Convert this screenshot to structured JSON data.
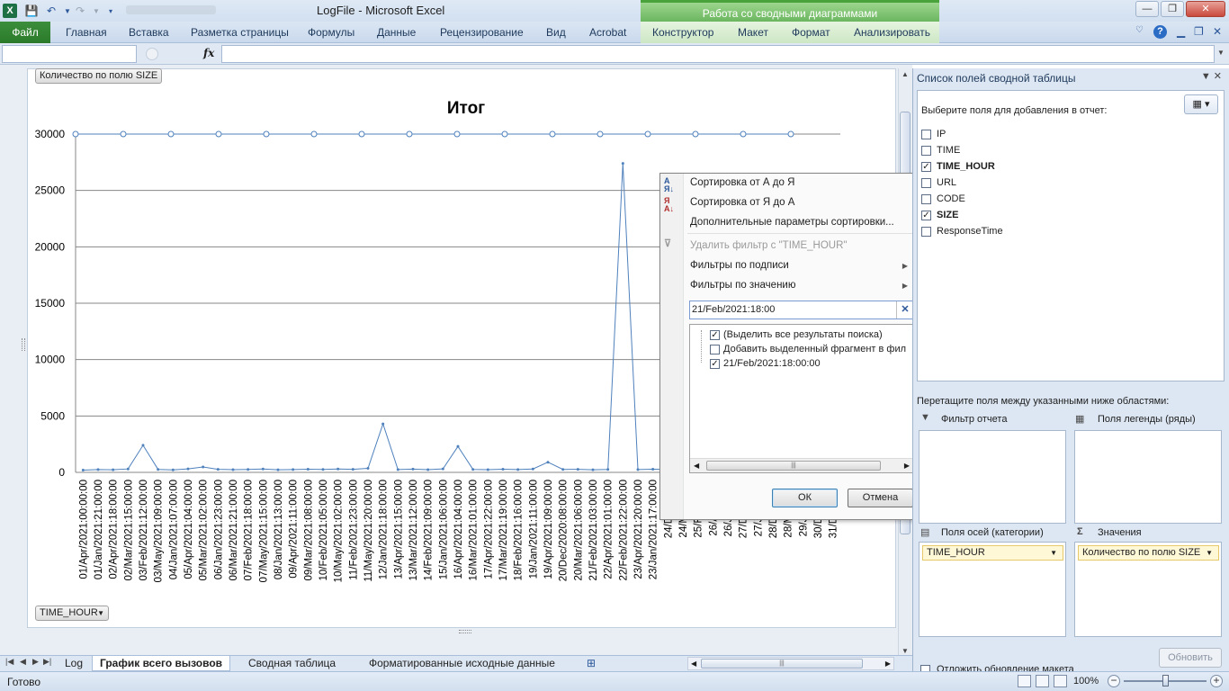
{
  "window": {
    "title": "LogFile  -  Microsoft Excel",
    "context_group": "Работа со сводными диаграммами",
    "controls": {
      "minimize": "—",
      "restore": "❐",
      "close": "✕"
    }
  },
  "ribbon": {
    "file_tab": "Файл",
    "tabs": [
      "Главная",
      "Вставка",
      "Разметка страницы",
      "Формулы",
      "Данные",
      "Рецензирование",
      "Вид",
      "Acrobat"
    ],
    "context_tabs": [
      "Конструктор",
      "Макет",
      "Формат",
      "Анализировать"
    ]
  },
  "formula_bar": {
    "fx": "fx",
    "name_box": "",
    "value": ""
  },
  "chart": {
    "value_field_button": "Количество по полю SIZE",
    "axis_field_button": "TIME_HOUR",
    "line_color": "#4f81bd"
  },
  "chart_data": {
    "type": "line",
    "title": "Итог",
    "xlabel": "",
    "ylabel": "",
    "ylim": [
      0,
      30000
    ],
    "yticks": [
      0,
      5000,
      10000,
      15000,
      20000,
      25000,
      30000
    ],
    "grid": true,
    "categories": [
      "01/Apr/2021:00:00:00",
      "01/Jan/2021:21:00:00",
      "02/Apr/2021:18:00:00",
      "02/Mar/2021:15:00:00",
      "03/Feb/2021:12:00:00",
      "03/May/2021:09:00:00",
      "04/Jan/2021:07:00:00",
      "05/Apr/2021:04:00:00",
      "05/Mar/2021:02:00:00",
      "06/Jan/2021:23:00:00",
      "06/Mar/2021:21:00:00",
      "07/Feb/2021:18:00:00",
      "07/May/2021:15:00:00",
      "08/Jan/2021:13:00:00",
      "09/Apr/2021:11:00:00",
      "09/Mar/2021:08:00:00",
      "10/Feb/2021:05:00:00",
      "10/May/2021:02:00:00",
      "11/Feb/2021:23:00:00",
      "11/May/2021:20:00:00",
      "12/Jan/2021:18:00:00",
      "13/Apr/2021:15:00:00",
      "13/Mar/2021:12:00:00",
      "14/Feb/2021:09:00:00",
      "15/Jan/2021:06:00:00",
      "16/Apr/2021:04:00:00",
      "16/Mar/2021:01:00:00",
      "17/Apr/2021:22:00:00",
      "17/Mar/2021:19:00:00",
      "18/Feb/2021:16:00:00",
      "19/Jan/2021:11:00:00",
      "19/Apr/2021:09:00:00",
      "20/Dec/2020:08:00:00",
      "20/Mar/2021:06:00:00",
      "21/Feb/2021:03:00:00",
      "22/Apr/2021:01:00:00",
      "22/Feb/2021:22:00:00",
      "23/Apr/2021:20:00:00",
      "23/Jan/2021:17:00:00",
      "24/Dec/2020",
      "24/Mar/2021",
      "25/Feb/2021",
      "26/Apr/2021",
      "26/Jan/2021",
      "27/Dec/2020",
      "27/Jan/2021",
      "28/Dec/2020",
      "28/Mar/2021",
      "29/Jan/2021",
      "30/Dec/2020",
      "31/Dec/2020"
    ],
    "series": [
      {
        "values": [
          200,
          250,
          230,
          300,
          2400,
          260,
          220,
          310,
          480,
          270,
          240,
          260,
          300,
          230,
          250,
          280,
          260,
          300,
          270,
          360,
          4300,
          250,
          290,
          240,
          310,
          2300,
          260,
          240,
          280,
          250,
          300,
          900,
          260,
          270,
          230,
          260,
          27400,
          250,
          280,
          260,
          300,
          240,
          270,
          250,
          260,
          280,
          250,
          270,
          260,
          300,
          260
        ]
      },
      {
        "values": [
          30000,
          30000,
          30000,
          30000,
          30000,
          30000,
          30000,
          30000,
          30000,
          30000,
          30000,
          30000,
          30000,
          30000,
          30000,
          30000
        ]
      }
    ]
  },
  "filter_menu": {
    "sort_asc": "Сортировка от А до Я",
    "sort_desc": "Сортировка от Я до А",
    "more_sort": "Дополнительные параметры сортировки...",
    "remove_filter": "Удалить фильтр с \"TIME_HOUR\"",
    "label_filters": "Фильтры по подписи",
    "value_filters": "Фильтры по значению",
    "search_value": "21/Feb/2021:18:00",
    "search_clear": "✕",
    "items": [
      {
        "label": "(Выделить все результаты поиска)",
        "checked": true
      },
      {
        "label": "Добавить выделенный фрагмент в фил",
        "checked": false
      },
      {
        "label": "21/Feb/2021:18:00:00",
        "checked": true
      }
    ],
    "ok": "ОК",
    "cancel": "Отмена"
  },
  "pivot_pane": {
    "title": "Список полей сводной таблицы",
    "subtitle": "Выберите поля для добавления в отчет:",
    "fields": [
      {
        "name": "IP",
        "checked": false
      },
      {
        "name": "TIME",
        "checked": false
      },
      {
        "name": "TIME_HOUR",
        "checked": true
      },
      {
        "name": "URL",
        "checked": false
      },
      {
        "name": "CODE",
        "checked": false
      },
      {
        "name": "SIZE",
        "checked": true
      },
      {
        "name": "ResponseTime",
        "checked": false
      }
    ],
    "drag_hint": "Перетащите поля между указанными ниже областями:",
    "areas": {
      "report_filter": "Фильтр отчета",
      "legend_fields": "Поля легенды (ряды)",
      "axis_fields": "Поля осей (категории)",
      "values": "Значения",
      "axis_chip": "TIME_HOUR",
      "values_chip": "Количество по полю SIZE"
    },
    "defer_update": "Отложить обновление макета",
    "update_button": "Обновить"
  },
  "sheet_tabs": [
    "Log",
    "График всего вызовов",
    "Сводная таблица",
    "Форматированные исходные данные"
  ],
  "active_sheet": "График всего вызовов",
  "status": {
    "ready": "Готово",
    "zoom": "100%"
  }
}
